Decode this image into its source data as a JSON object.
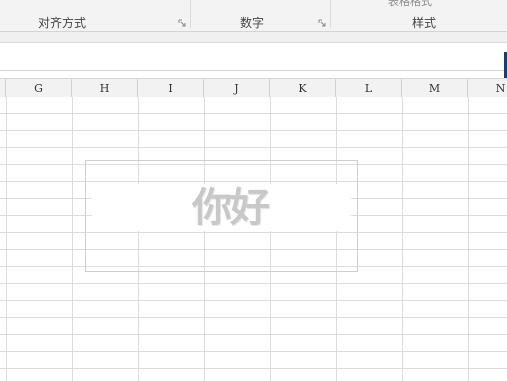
{
  "ribbon": {
    "cut_label": "表格格式",
    "groups": [
      {
        "label": "对齐方式"
      },
      {
        "label": "数字"
      },
      {
        "label": "样式"
      }
    ]
  },
  "columns": [
    "G",
    "H",
    "I",
    "J",
    "K",
    "L",
    "M",
    "N"
  ],
  "shape": {
    "text": "你好"
  }
}
